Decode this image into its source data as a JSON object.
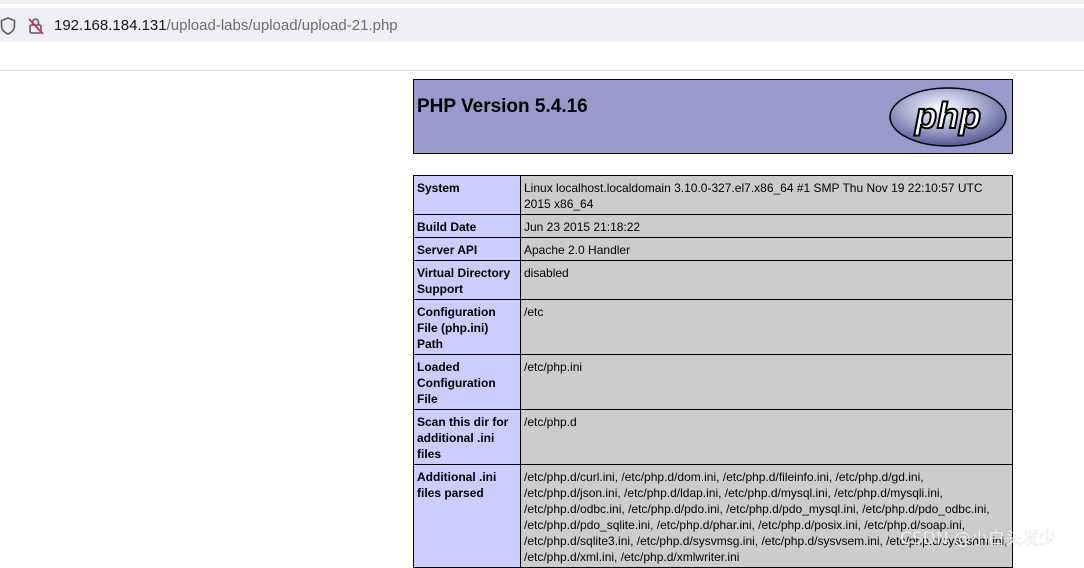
{
  "browser": {
    "url_host": "192.168.184.131",
    "url_path": "/upload-labs/upload/upload-21.php"
  },
  "phpinfo": {
    "title": "PHP Version 5.4.16",
    "logo_text": "php",
    "rows": [
      {
        "key": "System",
        "value": "Linux localhost.localdomain 3.10.0-327.el7.x86_64 #1 SMP Thu Nov 19 22:10:57 UTC 2015 x86_64"
      },
      {
        "key": "Build Date",
        "value": "Jun 23 2015 21:18:22"
      },
      {
        "key": "Server API",
        "value": "Apache 2.0 Handler"
      },
      {
        "key": "Virtual Directory Support",
        "value": "disabled"
      },
      {
        "key": "Configuration File (php.ini) Path",
        "value": "/etc"
      },
      {
        "key": "Loaded Configuration File",
        "value": "/etc/php.ini"
      },
      {
        "key": "Scan this dir for additional .ini files",
        "value": "/etc/php.d"
      },
      {
        "key": "Additional .ini files parsed",
        "value": "/etc/php.d/curl.ini, /etc/php.d/dom.ini, /etc/php.d/fileinfo.ini, /etc/php.d/gd.ini, /etc/php.d/json.ini, /etc/php.d/ldap.ini, /etc/php.d/mysql.ini, /etc/php.d/mysqli.ini, /etc/php.d/odbc.ini, /etc/php.d/pdo.ini, /etc/php.d/pdo_mysql.ini, /etc/php.d/pdo_odbc.ini, /etc/php.d/pdo_sqlite.ini, /etc/php.d/phar.ini, /etc/php.d/posix.ini, /etc/php.d/soap.ini, /etc/php.d/sqlite3.ini, /etc/php.d/sysvmsg.ini, /etc/php.d/sysvsem.ini, /etc/php.d/sysvshm.ini, /etc/php.d/xml.ini, /etc/php.d/xmlwriter.ini"
      }
    ]
  },
  "watermark": "CSDN @小白头发少",
  "colors": {
    "header_bg": "#9999cc",
    "key_bg": "#ccccff",
    "value_bg": "#cccccc"
  }
}
